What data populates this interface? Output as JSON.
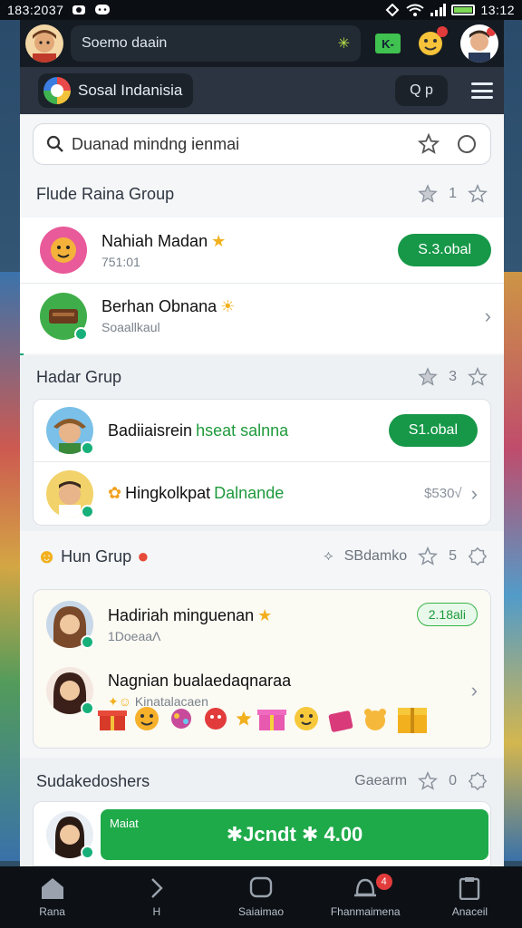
{
  "status_bar": {
    "time": "183:2037",
    "right_time": "13:12"
  },
  "top_header": {
    "profile_name": "Soemo daain",
    "sparkle_icon": "sparkle-icon",
    "action_label": "K-"
  },
  "app_bar": {
    "app_name": "Sosal Indanisia",
    "search_label": "Q p"
  },
  "search": {
    "placeholder": "Duanad mindng ienmai"
  },
  "sections": [
    {
      "title": "Flude Raina Group",
      "count": "1",
      "rows": [
        {
          "name": "Nahiah Madan",
          "subtitle": "751:01",
          "action": "S.3.obal"
        },
        {
          "name": "Berhan Obnana",
          "subtitle": "Soaallkaul"
        }
      ]
    },
    {
      "title": "Hadar Grup",
      "count": "3",
      "rows": [
        {
          "name_prefix": "Badiiaisrein",
          "name_highlight": "hseat salnna",
          "action": "S1.obal"
        },
        {
          "name": "Hingkolkpat",
          "name_highlight": "Dalnande",
          "right_text": "$530√"
        }
      ]
    },
    {
      "title": "Hun Grup",
      "right_label": "SBdamko",
      "count": "5",
      "rows": [
        {
          "name": "Hadiriah minguenan",
          "subtitle": "1DoeaaΛ",
          "action": "2.18ali"
        },
        {
          "name": "Nagnian bualaedaqnaraa",
          "subtitle": "Kinatalacaen"
        }
      ]
    },
    {
      "title": "Sudakedoshers",
      "right_label": "Gaearm",
      "count": "0",
      "cta_small": "Maiat",
      "cta": "✱Jcndt ✱ 4.00"
    }
  ],
  "bottom_nav": [
    {
      "label": "Rana",
      "icon": "home-icon"
    },
    {
      "label": "H",
      "icon": "chevron-right-icon"
    },
    {
      "label": "Saiaimao",
      "icon": "chat-icon"
    },
    {
      "label": "Fhanmaimena",
      "icon": "bell-icon",
      "badge": "4"
    },
    {
      "label": "Anaceil",
      "icon": "clipboard-icon"
    }
  ],
  "colors": {
    "accent_green": "#169848",
    "online_dot": "#18b07a",
    "notif_red": "#e23b3b"
  }
}
